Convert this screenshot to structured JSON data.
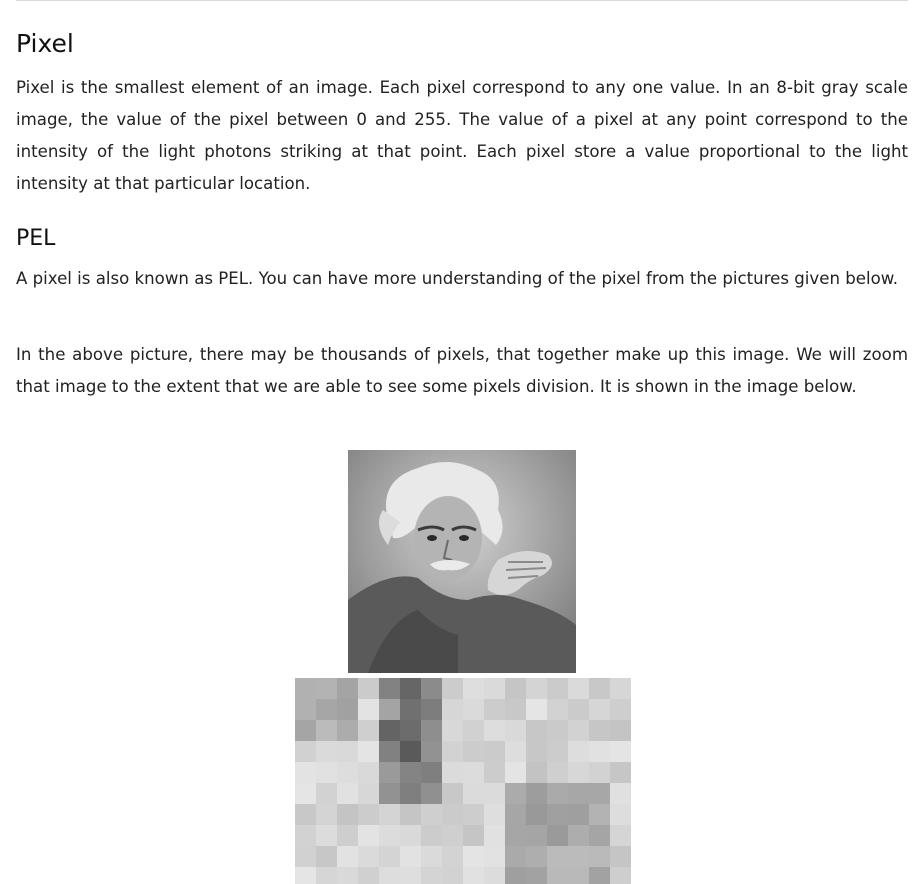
{
  "article": {
    "heading_pixel": "Pixel",
    "paragraph_1": "Pixel is the smallest element of an image. Each pixel correspond to any one value. In an 8-bit gray scale image, the value of the pixel between 0 and 255. The value of a pixel at any point correspond to the intensity of the light photons striking at that point. Each pixel store a value proportional to the light intensity at that particular location.",
    "heading_pel": "PEL",
    "paragraph_2": "A pixel is also known as PEL. You can have more understanding of the pixel from the pictures given below.",
    "paragraph_3": "In the above picture, there may be thousands of pixels, that together make up this image. We will zoom that image to the extent that we are able to see some pixels division. It is shown in the image below."
  },
  "colors": {
    "text": "#222222",
    "heading": "#111111",
    "rule": "#d9d9d9"
  }
}
